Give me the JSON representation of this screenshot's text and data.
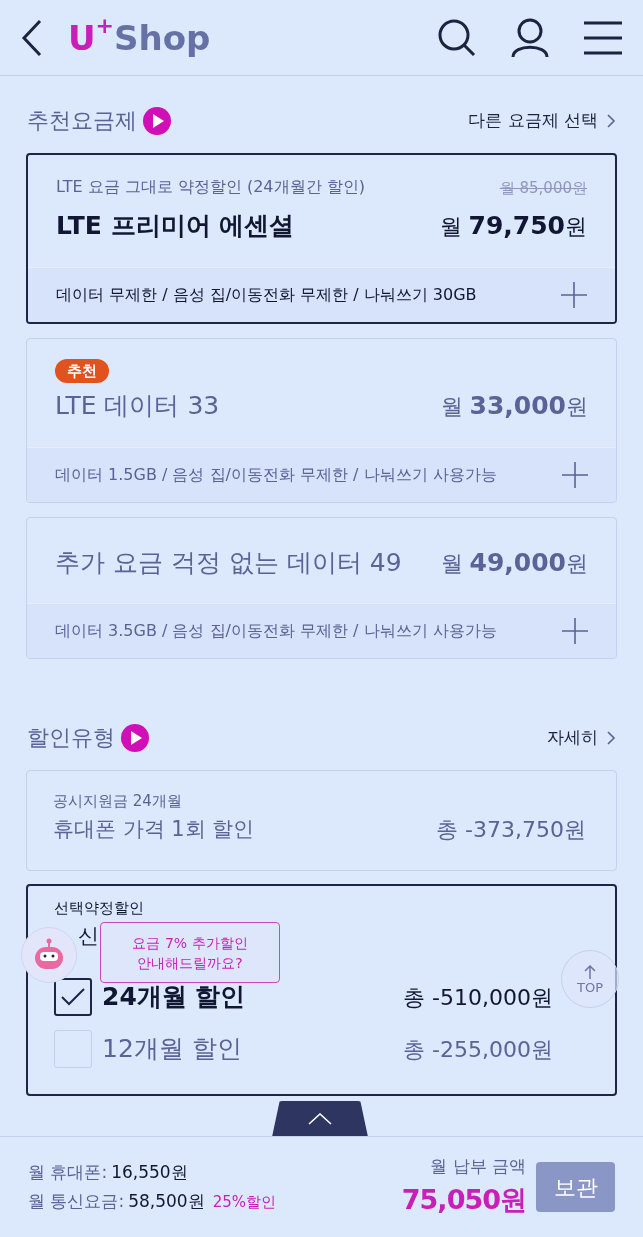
{
  "header": {
    "logo_mark": "U",
    "logo_sup": "+",
    "logo_text": "Shop"
  },
  "plans_section": {
    "title": "추천요금제",
    "link": "다른 요금제 선택"
  },
  "plans": [
    {
      "selected": true,
      "subtitle": "LTE 요금 그대로 약정할인 (24개월간 할인)",
      "original_price": "월 85,000원",
      "name": "LTE 프리미어 에센셜",
      "price": "월 **79,750**원",
      "features": "데이터 무제한 / 음성 집/이동전화 무제한 / 나눠쓰기 30GB"
    },
    {
      "selected": false,
      "badge": "추천",
      "name": "LTE 데이터 33",
      "price": "월 **33,000**원",
      "features": "데이터 1.5GB / 음성 집/이동전화 무제한 / 나눠쓰기 사용가능"
    },
    {
      "selected": false,
      "name": "추가 요금 걱정 없는 데이터 49",
      "price": "월 **49,000**원",
      "features": "데이터 3.5GB / 음성 집/이동전화 무제한 / 나눠쓰기 사용가능"
    }
  ],
  "discount_section": {
    "title": "할인유형",
    "link": "자세히"
  },
  "discounts": [
    {
      "selected": false,
      "subtitle": "공시지원금 24개월",
      "name": "휴대폰 가격 1회 할인",
      "total": "총 -373,750원"
    },
    {
      "selected": true,
      "subtitle": "선택약정할인",
      "name": "신",
      "options": [
        {
          "label": "24개월 할인",
          "total": "총 -510,000원",
          "checked": true
        },
        {
          "label": "12개월 할인",
          "total": "총 -255,000원",
          "checked": false
        }
      ]
    }
  ],
  "chat_tooltip": "요금 7% 추가할인\n안내해드릴까요?",
  "top_button": "TOP",
  "summary": {
    "phone_label": "월 휴대폰:",
    "phone_value": "16,550원",
    "plan_label": "월 통신요금:",
    "plan_value": "58,500원",
    "plan_discount": "25%할인",
    "total_label": "월 납부 금액",
    "total_value": "75,050원",
    "save_button": "보관"
  }
}
